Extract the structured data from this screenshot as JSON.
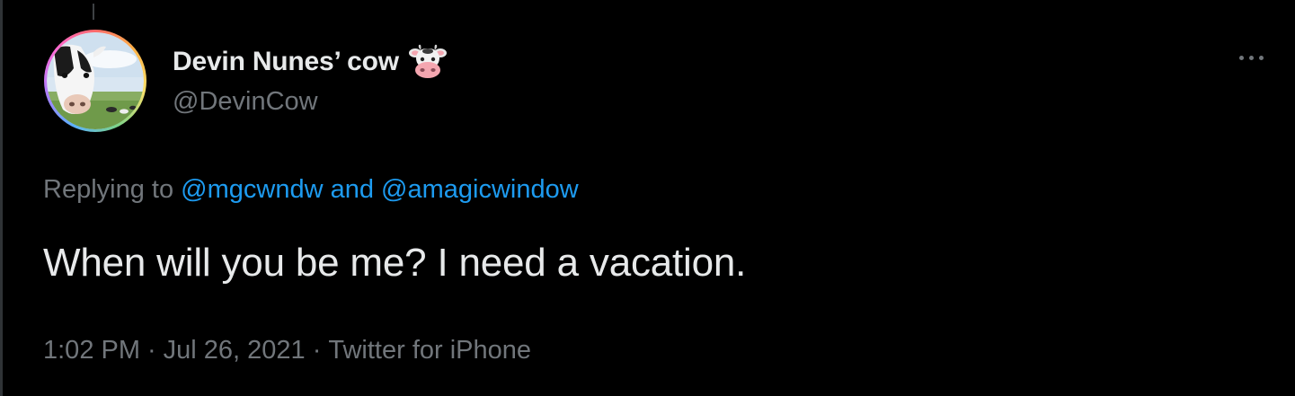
{
  "tweet": {
    "display_name": "Devin Nunes’ cow",
    "name_emoji_icon": "cow-face-icon",
    "handle": "@DevinCow",
    "reply": {
      "prefix": "Replying to",
      "mention_1": "@mgcwndw",
      "conjunction": "and",
      "mention_2": "@amagicwindow"
    },
    "text": "When will you be me? I need a vacation.",
    "time": "1:02 PM",
    "separator": "·",
    "date": "Jul 26, 2021",
    "source": "Twitter for iPhone",
    "more_icon": "more-horizontal-icon"
  },
  "colors": {
    "background": "#000000",
    "primary_text": "#e7e9ea",
    "secondary_text": "#71767b",
    "link": "#1d9bf0"
  }
}
